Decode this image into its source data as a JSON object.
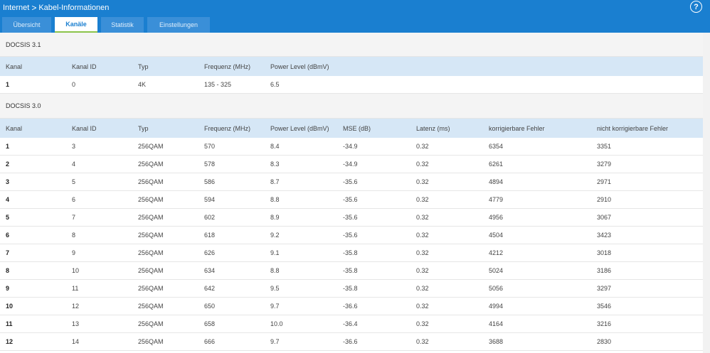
{
  "breadcrumb": {
    "parent": "Internet",
    "separator": ">",
    "current": "Kabel-Informationen"
  },
  "help_label": "?",
  "tabs": [
    {
      "label": "Übersicht"
    },
    {
      "label": "Kanäle"
    },
    {
      "label": "Statistik"
    },
    {
      "label": "Einstellungen"
    }
  ],
  "active_tab": "Kanäle",
  "colors": {
    "header_bg": "#1a7fd0",
    "active_tab_underline": "#8bc34a",
    "table_header_bg": "#d6e7f6"
  },
  "docsis31": {
    "title": "DOCSIS 3.1",
    "headers": [
      "Kanal",
      "Kanal ID",
      "Typ",
      "Frequenz (MHz)",
      "Power Level (dBmV)"
    ],
    "rows": [
      [
        "1",
        "0",
        "4K",
        "135 - 325",
        "6.5"
      ]
    ]
  },
  "docsis30": {
    "title": "DOCSIS 3.0",
    "headers": [
      "Kanal",
      "Kanal ID",
      "Typ",
      "Frequenz (MHz)",
      "Power Level (dBmV)",
      "MSE (dB)",
      "Latenz (ms)",
      "korrigierbare Fehler",
      "nicht korrigierbare Fehler"
    ],
    "rows": [
      [
        "1",
        "3",
        "256QAM",
        "570",
        "8.4",
        "-34.9",
        "0.32",
        "6354",
        "3351"
      ],
      [
        "2",
        "4",
        "256QAM",
        "578",
        "8.3",
        "-34.9",
        "0.32",
        "6261",
        "3279"
      ],
      [
        "3",
        "5",
        "256QAM",
        "586",
        "8.7",
        "-35.6",
        "0.32",
        "4894",
        "2971"
      ],
      [
        "4",
        "6",
        "256QAM",
        "594",
        "8.8",
        "-35.6",
        "0.32",
        "4779",
        "2910"
      ],
      [
        "5",
        "7",
        "256QAM",
        "602",
        "8.9",
        "-35.6",
        "0.32",
        "4956",
        "3067"
      ],
      [
        "6",
        "8",
        "256QAM",
        "618",
        "9.2",
        "-35.6",
        "0.32",
        "4504",
        "3423"
      ],
      [
        "7",
        "9",
        "256QAM",
        "626",
        "9.1",
        "-35.8",
        "0.32",
        "4212",
        "3018"
      ],
      [
        "8",
        "10",
        "256QAM",
        "634",
        "8.8",
        "-35.8",
        "0.32",
        "5024",
        "3186"
      ],
      [
        "9",
        "11",
        "256QAM",
        "642",
        "9.5",
        "-35.8",
        "0.32",
        "5056",
        "3297"
      ],
      [
        "10",
        "12",
        "256QAM",
        "650",
        "9.7",
        "-36.6",
        "0.32",
        "4994",
        "3546"
      ],
      [
        "11",
        "13",
        "256QAM",
        "658",
        "10.0",
        "-36.4",
        "0.32",
        "4164",
        "3216"
      ],
      [
        "12",
        "14",
        "256QAM",
        "666",
        "9.7",
        "-36.6",
        "0.32",
        "3688",
        "2830"
      ]
    ]
  }
}
